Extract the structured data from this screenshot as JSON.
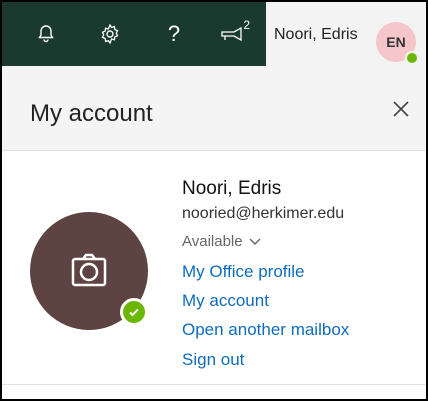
{
  "topbar": {
    "icons": [
      "bell-icon",
      "gear-icon",
      "help-icon",
      "feedback-icon"
    ],
    "help_glyph": "?",
    "feedback_count": "2",
    "account_name": "Noori, Edris",
    "initials": "EN",
    "presence_color": "#6bb700"
  },
  "panel": {
    "title": "My account",
    "user_name": "Noori, Edris",
    "email": "nooried@herkimer.edu",
    "status": "Available",
    "links": [
      "My Office profile",
      "My account",
      "Open another mailbox",
      "Sign out"
    ],
    "link_color": "#0f6cbd",
    "avatar_color": "#5d4443"
  }
}
